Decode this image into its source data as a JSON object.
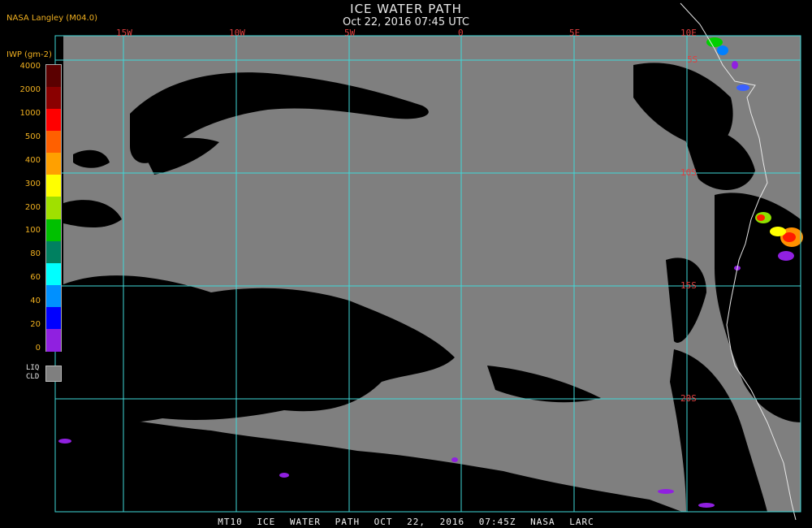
{
  "header": {
    "title": "ICE WATER PATH",
    "subtitle": "Oct 22, 2016 07:45 UTC",
    "source": "NASA Langley (M04.0)"
  },
  "footer": {
    "caption": "MT10 ICE WATER PATH OCT 22, 2016 07:45Z NASA LARC"
  },
  "map": {
    "background_color": "#7f7f7f",
    "grid_color": "#3fd8d8",
    "label_color": "#e04040",
    "longitude_labels": [
      "15W",
      "10W",
      "5W",
      "0",
      "5E",
      "10E"
    ],
    "latitude_labels": [
      "5S",
      "10S",
      "15S",
      "20S"
    ]
  },
  "legend": {
    "title": "IWP (gm-2)",
    "ticks": [
      "4000",
      "2000",
      "1000",
      "500",
      "400",
      "300",
      "200",
      "100",
      "80",
      "60",
      "40",
      "20",
      "0"
    ],
    "colors": [
      "#5a0000",
      "#8a0000",
      "#ff0000",
      "#ff6000",
      "#ffa000",
      "#ffff00",
      "#a0e000",
      "#00c000",
      "#008060",
      "#00ffff",
      "#0090ff",
      "#0000ff",
      "#9020e0"
    ],
    "liq_label_line1": "LIQ",
    "liq_label_line2": "CLD"
  }
}
